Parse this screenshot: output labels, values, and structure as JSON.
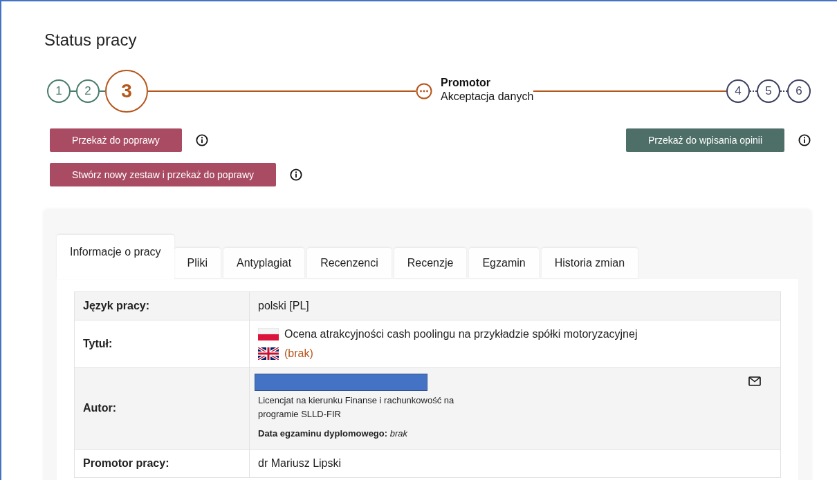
{
  "title": "Status pracy",
  "steps": [
    {
      "kind": "done",
      "label": "1"
    },
    {
      "kind": "done",
      "label": "2"
    },
    {
      "kind": "current",
      "label": "3"
    },
    {
      "kind": "substep",
      "title": "Promotor",
      "subtitle": "Akceptacja danych"
    },
    {
      "kind": "pending",
      "label": "4"
    },
    {
      "kind": "pending",
      "label": "5"
    },
    {
      "kind": "pending",
      "label": "6"
    }
  ],
  "actions_left": [
    {
      "label": "Przekaż do poprawy",
      "kind": "danger"
    },
    {
      "label": "Stwórz nowy zestaw i przekaż do poprawy",
      "kind": "danger"
    }
  ],
  "actions_right": [
    {
      "label": "Przekaż do wpisania opinii",
      "kind": "primary"
    }
  ],
  "tabs": [
    {
      "label": "Informacje o pracy",
      "selected": true
    },
    {
      "label": "Pliki",
      "selected": false
    },
    {
      "label": "Antyplagiat",
      "selected": false
    },
    {
      "label": "Recenzenci",
      "selected": false
    },
    {
      "label": "Recenzje",
      "selected": false
    },
    {
      "label": "Egzamin",
      "selected": false
    },
    {
      "label": "Historia zmian",
      "selected": false
    }
  ],
  "rows": [
    {
      "kind": "text",
      "label": "Język pracy:",
      "value": "polski [PL]"
    },
    {
      "kind": "titles",
      "label": "Tytuł:",
      "titles": [
        {
          "kind": "pl",
          "text": "Ocena atrakcyjności cash poolingu na przykładzie spółki motoryzacyjnej",
          "missing": false
        },
        {
          "kind": "gb",
          "text": "(brak)",
          "missing": true
        }
      ]
    },
    {
      "kind": "author",
      "label": "Autor:",
      "study": "Licencjat na kierunku Finanse i rachunkowość na programie SLLD-FIR",
      "exam_label": "Data egzaminu dyplomowego:",
      "exam_value": "brak"
    },
    {
      "kind": "text",
      "label": "Promotor pracy:",
      "value": "dr Mariusz Lipski"
    }
  ]
}
